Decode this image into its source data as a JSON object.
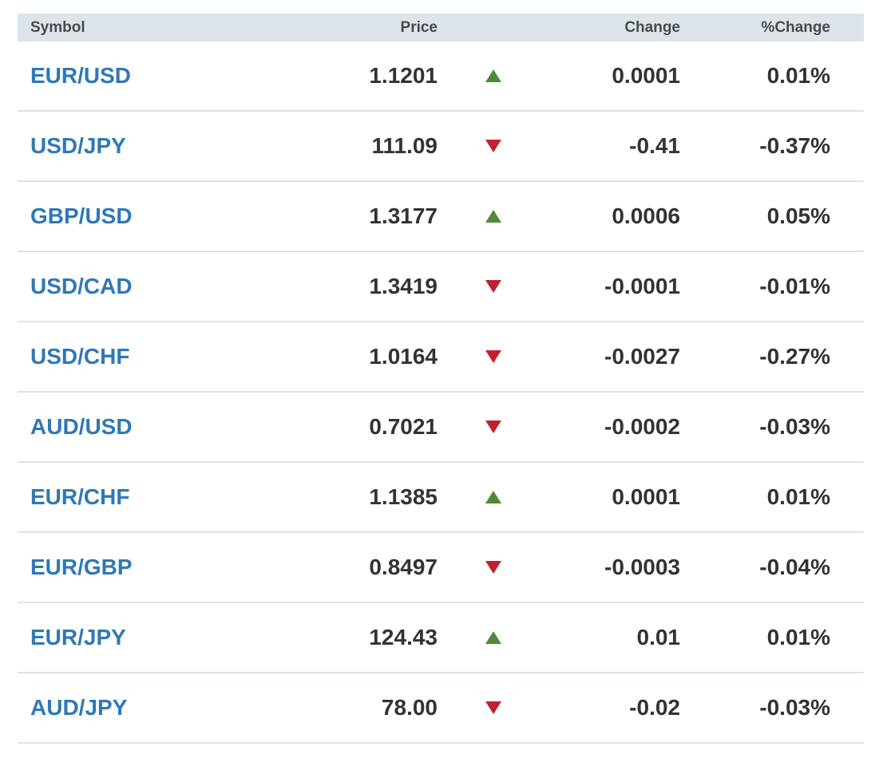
{
  "table": {
    "headers": {
      "symbol": "Symbol",
      "price": "Price",
      "change": "Change",
      "pct_change": "%Change"
    },
    "colors": {
      "up": "#4f8a3a",
      "down": "#c2202e",
      "link": "#2f78b7",
      "header_bg": "#dce4ea"
    },
    "rows": [
      {
        "symbol": "EUR/USD",
        "price": "1.1201",
        "direction": "up",
        "change": "0.0001",
        "pct_change": "0.01%"
      },
      {
        "symbol": "USD/JPY",
        "price": "111.09",
        "direction": "down",
        "change": "-0.41",
        "pct_change": "-0.37%"
      },
      {
        "symbol": "GBP/USD",
        "price": "1.3177",
        "direction": "up",
        "change": "0.0006",
        "pct_change": "0.05%"
      },
      {
        "symbol": "USD/CAD",
        "price": "1.3419",
        "direction": "down",
        "change": "-0.0001",
        "pct_change": "-0.01%"
      },
      {
        "symbol": "USD/CHF",
        "price": "1.0164",
        "direction": "down",
        "change": "-0.0027",
        "pct_change": "-0.27%"
      },
      {
        "symbol": "AUD/USD",
        "price": "0.7021",
        "direction": "down",
        "change": "-0.0002",
        "pct_change": "-0.03%"
      },
      {
        "symbol": "EUR/CHF",
        "price": "1.1385",
        "direction": "up",
        "change": "0.0001",
        "pct_change": "0.01%"
      },
      {
        "symbol": "EUR/GBP",
        "price": "0.8497",
        "direction": "down",
        "change": "-0.0003",
        "pct_change": "-0.04%"
      },
      {
        "symbol": "EUR/JPY",
        "price": "124.43",
        "direction": "up",
        "change": "0.01",
        "pct_change": "0.01%"
      },
      {
        "symbol": "AUD/JPY",
        "price": "78.00",
        "direction": "down",
        "change": "-0.02",
        "pct_change": "-0.03%"
      }
    ]
  }
}
